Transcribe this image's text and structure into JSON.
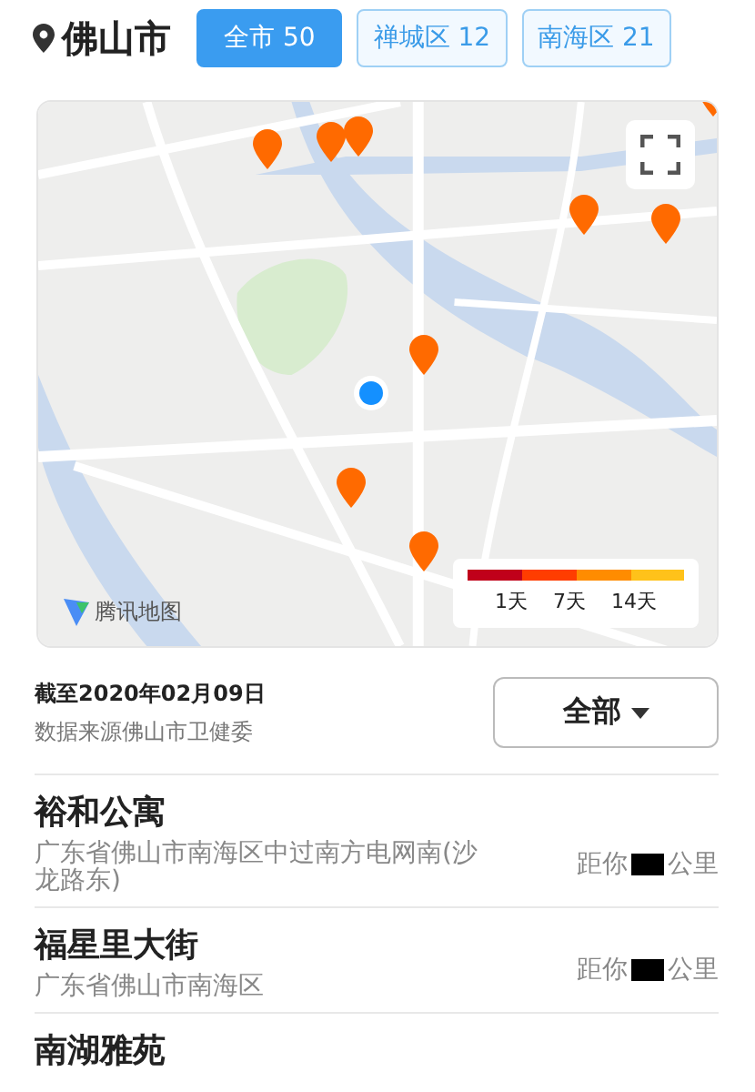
{
  "header": {
    "city": "佛山市"
  },
  "tabs": [
    {
      "label": "全市 50",
      "selected": true
    },
    {
      "label": "禅城区 12",
      "selected": false
    },
    {
      "label": "南海区 21",
      "selected": false
    }
  ],
  "map": {
    "legend": {
      "labels": [
        "1天",
        "7天",
        "14天"
      ]
    },
    "logo": "腾讯地图"
  },
  "info": {
    "date": "截至2020年02月09日",
    "source": "数据来源佛山市卫健委"
  },
  "filter": {
    "label": "全部"
  },
  "places": [
    {
      "name": "裕和公寓",
      "address": "广东省佛山市南海区中过南方电网南(沙龙路东)",
      "distance_prefix": "距你",
      "distance_suffix": "公里"
    },
    {
      "name": "福星里大街",
      "address": "广东省佛山市南海区",
      "distance_prefix": "距你",
      "distance_suffix": "公里"
    },
    {
      "name": "南湖雅苑"
    }
  ]
}
